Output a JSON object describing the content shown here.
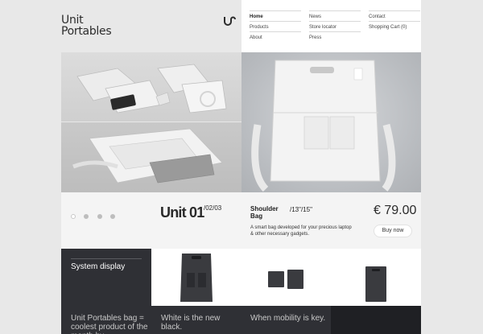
{
  "brand": {
    "line1": "Unit",
    "line2": "Portables"
  },
  "nav": {
    "col1": [
      "Home",
      "Products",
      "About"
    ],
    "col2": [
      "News",
      "Store locator",
      "Press"
    ],
    "col3": [
      "Contact",
      "Shopping Cart (0)"
    ]
  },
  "product": {
    "unit_title": "Unit 01",
    "unit_pages": "/02/03",
    "name": "Shoulder Bag",
    "sizes": "/13\"/15\"",
    "price": "€ 79.00",
    "description": "A smart bag developed for your precious laptop & other necessary gadgets.",
    "buy_label": "Buy now"
  },
  "slider": {
    "dot_count": 4,
    "active_index": 0
  },
  "tiles": {
    "system_display_label": "System display"
  },
  "bottom": {
    "texts": [
      "Unit Portables bag = coolest product of the month by",
      "White is the new black.",
      "When mobility is key."
    ]
  },
  "colors": {
    "dark_tile": "#2f3035",
    "background": "#e8e8e8",
    "info_band": "#f4f4f4"
  }
}
